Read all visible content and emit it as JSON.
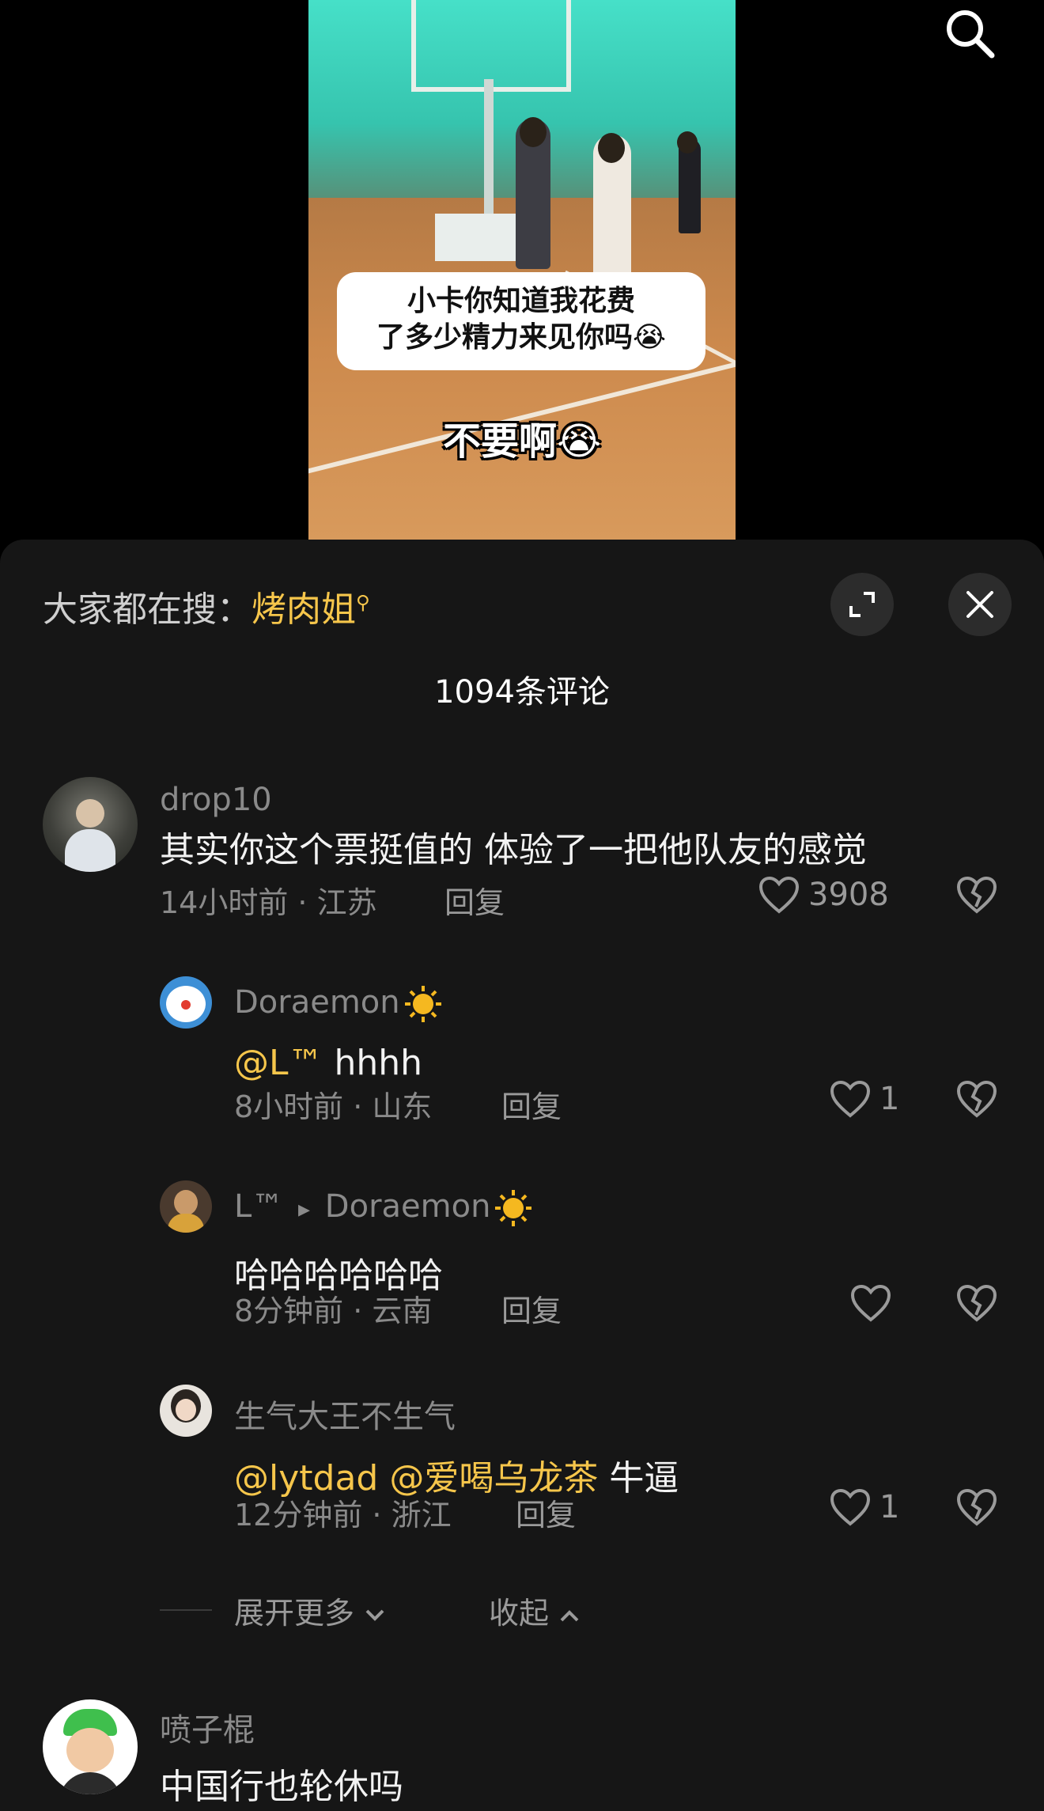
{
  "video": {
    "bubble_line1": "小卡你知道我花费",
    "bubble_line2": "了多少精力来见你吗😭",
    "caption": "不要啊😭"
  },
  "search_icon": "search-icon",
  "panel": {
    "hot_label": "大家都在搜：",
    "hot_keyword": "烤肉姐",
    "expand_icon": "expand-icon",
    "close_icon": "close-icon",
    "comment_count": "1094条评论"
  },
  "comments": [
    {
      "user": "drop10",
      "text": "其实你这个票挺值的 体验了一把他队友的感觉",
      "meta": "14小时前 · 江苏",
      "reply": "回复",
      "likes": "3908"
    },
    {
      "user": "Doraemon",
      "user_emoji": "🌞",
      "mention": "@L™",
      "text": " hhhh",
      "meta": "8小时前 · 山东",
      "reply": "回复",
      "likes": "1"
    },
    {
      "user": "L™",
      "arrow": "▸",
      "target": "Doraemon",
      "text": "哈哈哈哈哈哈",
      "meta": "8分钟前 · 云南",
      "reply": "回复",
      "likes": ""
    },
    {
      "user": "生气大王不生气",
      "mention": "@lytdad @爱喝乌龙茶",
      "text": "  牛逼",
      "meta": "12分钟前 · 浙江",
      "reply": "回复",
      "likes": "1"
    },
    {
      "user": "喷子棍",
      "text": "中国行也轮休吗"
    }
  ],
  "thread": {
    "expand_more": "展开更多",
    "collapse": "收起"
  },
  "colors": {
    "accent": "#f6c64b",
    "panel_bg": "#161616"
  }
}
